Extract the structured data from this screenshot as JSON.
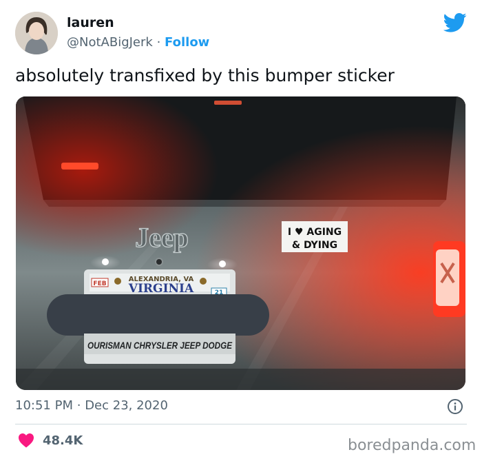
{
  "author": {
    "name": "lauren",
    "handle": "@NotABigJerk",
    "separator": "·",
    "follow_label": "Follow"
  },
  "tweet": {
    "text": "absolutely transfixed by this bumper sticker"
  },
  "photo": {
    "logo_text": "Jeep",
    "sticker_line1": "I ♥ AGING",
    "sticker_line2": "& DYING",
    "plate_top": "ALEXANDRIA, VA",
    "plate_state": "VIRGINIA",
    "plate_month": "FEB",
    "plate_year": "21",
    "plate_frame_bottom": "OURISMAN CHRYSLER JEEP DODGE"
  },
  "meta": {
    "time": "10:51 PM",
    "separator": "·",
    "date": "Dec 23, 2020"
  },
  "stats": {
    "likes": "48.4K"
  },
  "watermark": "boredpanda.com",
  "colors": {
    "accent": "#1d9bf0",
    "like": "#f91880",
    "secondary_text": "#536471"
  },
  "icons": {
    "brand": "twitter-bird-icon",
    "info": "info-icon",
    "like": "heart-icon"
  }
}
